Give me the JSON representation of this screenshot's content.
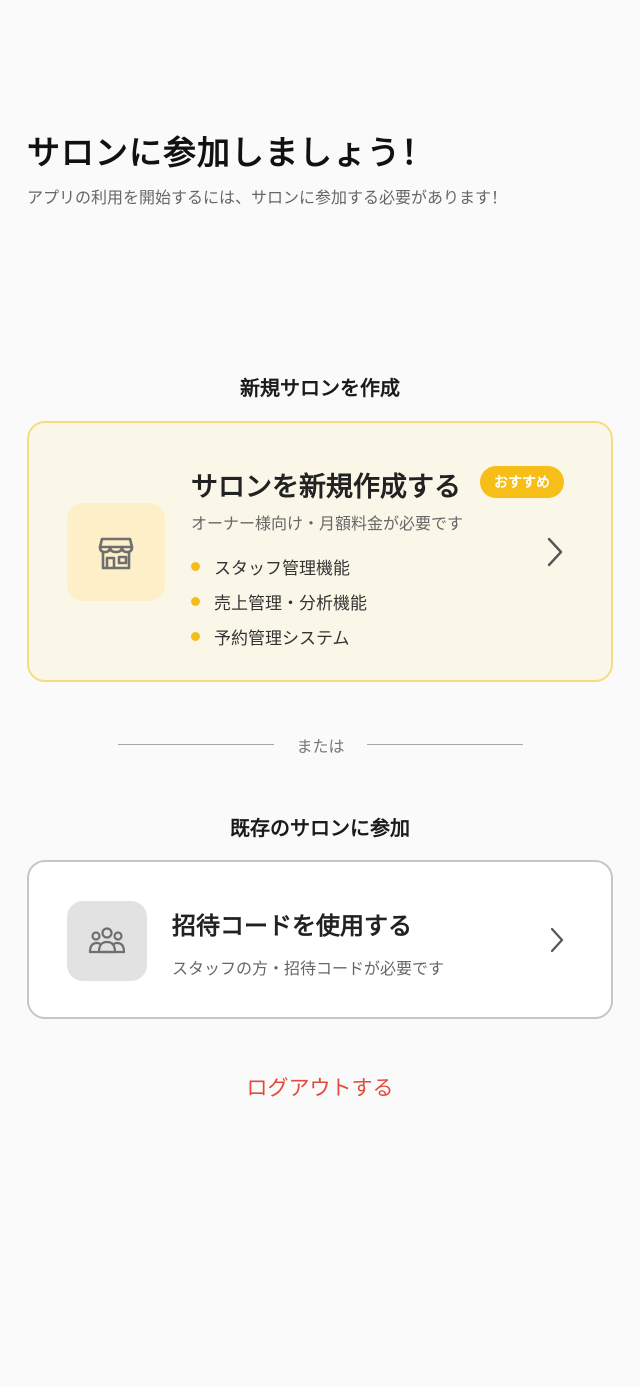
{
  "header": {
    "title": "サロンに参加しましょう！",
    "subtitle": "アプリの利用を開始するには、サロンに参加する必要があります！"
  },
  "create_section": {
    "title": "新規サロンを作成",
    "card": {
      "heading": "サロンを新規作成する",
      "badge": "おすすめ",
      "description": "オーナー様向け・月額料金が必要です",
      "features": [
        "スタッフ管理機能",
        "売上管理・分析機能",
        "予約管理システム"
      ],
      "icon": "store-icon"
    }
  },
  "divider": {
    "text": "または"
  },
  "join_section": {
    "title": "既存のサロンに参加",
    "card": {
      "heading": "招待コードを使用する",
      "description": "スタッフの方・招待コードが必要です",
      "icon": "group-icon"
    }
  },
  "logout": {
    "label": "ログアウトする"
  },
  "colors": {
    "accent": "#f7be17",
    "create_card_bg": "#faf7e9",
    "create_card_border": "#f6db83",
    "logout": "#e24b3c"
  }
}
